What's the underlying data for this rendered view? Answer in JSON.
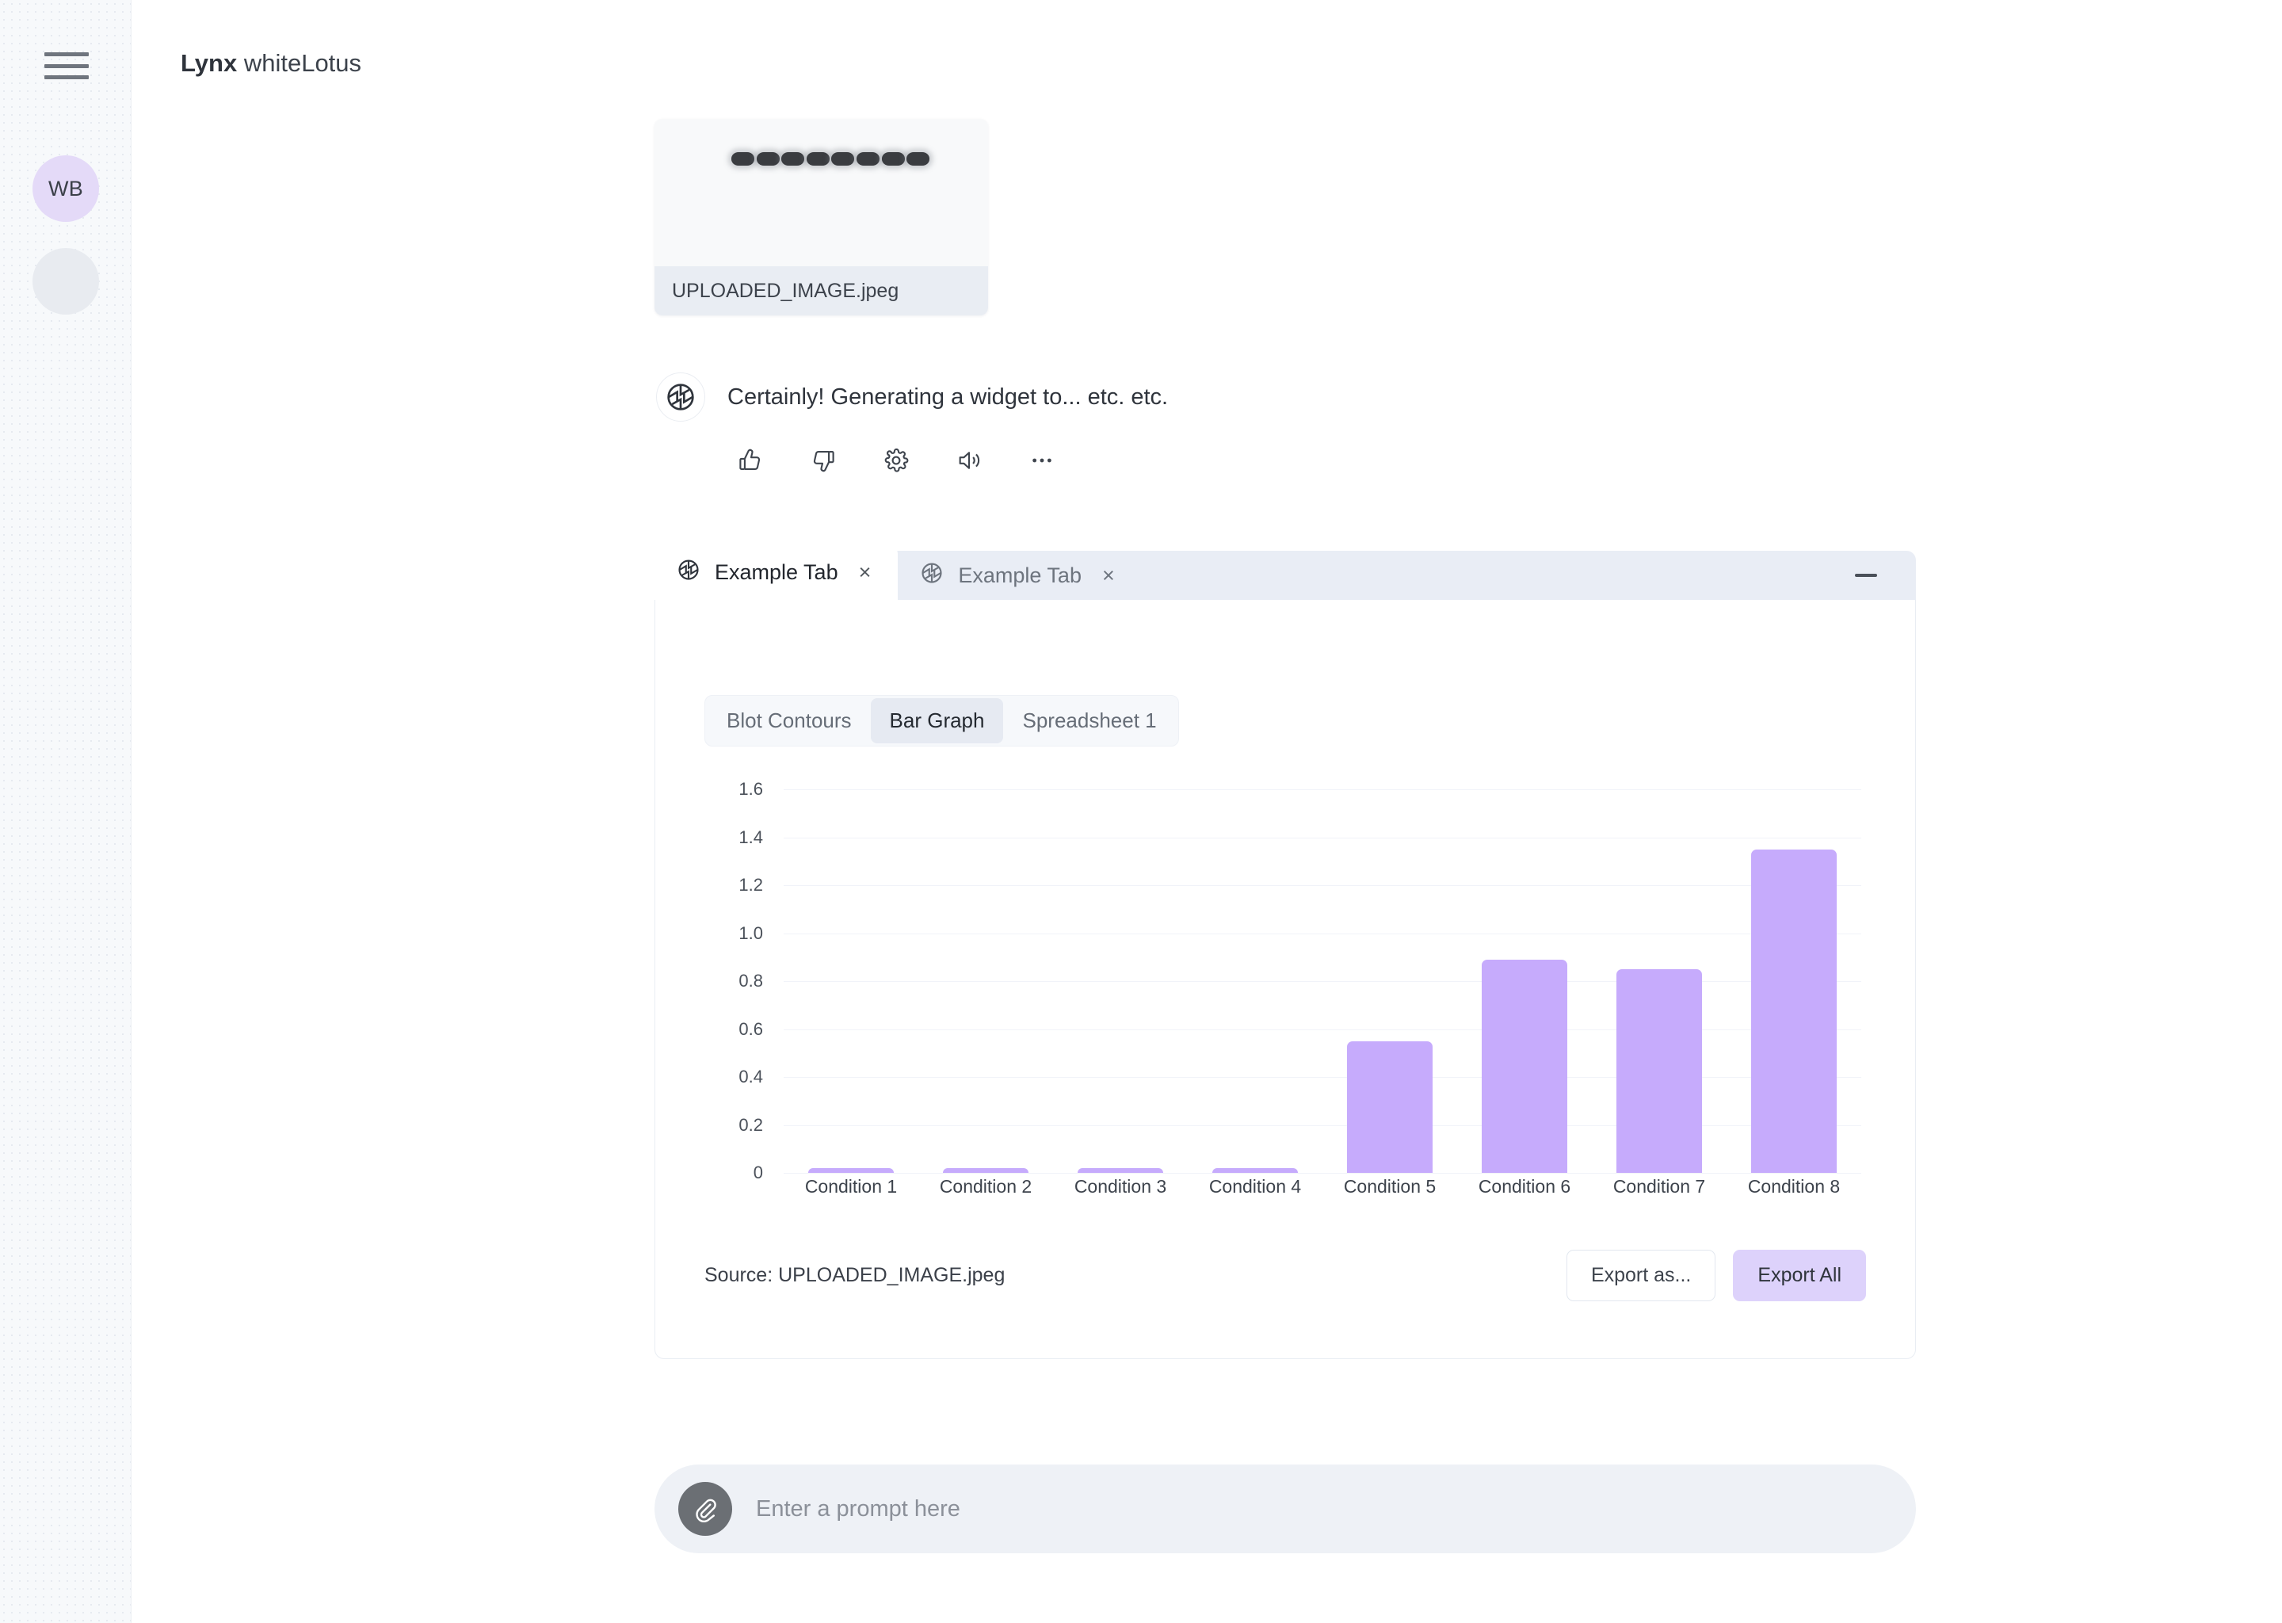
{
  "app": {
    "brand_strong": "Lynx",
    "brand_light": "whiteLotus",
    "accent": "#c6abfc",
    "accent_soft": "#ddd2fb",
    "avatar_bg": "#e4daf8"
  },
  "sidebar": {
    "menu_icon": "hamburger-icon",
    "avatar_initials": "WB",
    "placeholder_avatar": ""
  },
  "upload": {
    "filename": "UPLOADED_IMAGE.jpeg",
    "band_count": 8,
    "alt": "western-blot-strip"
  },
  "assistant": {
    "avatar_icon": "aperture-icon",
    "message": "Certainly! Generating a widget to... etc. etc.",
    "actions": [
      {
        "name": "thumbs-up-icon",
        "label": "Like"
      },
      {
        "name": "thumbs-down-icon",
        "label": "Dislike"
      },
      {
        "name": "gear-icon",
        "label": "Settings"
      },
      {
        "name": "speaker-icon",
        "label": "Read aloud"
      },
      {
        "name": "ellipsis-icon",
        "label": "More"
      }
    ]
  },
  "widget": {
    "tabs": [
      {
        "label": "Example Tab",
        "active": true,
        "close": "×"
      },
      {
        "label": "Example Tab",
        "active": false,
        "close": "×"
      }
    ],
    "minimize_label": "—",
    "segmented": [
      {
        "label": "Blot Contours",
        "active": false
      },
      {
        "label": "Bar Graph",
        "active": true
      },
      {
        "label": "Spreadsheet 1",
        "active": false
      }
    ],
    "footer": {
      "source_label": "Source:",
      "source_name": "UPLOADED_IMAGE.jpeg",
      "export_as_label": "Export as...",
      "export_all_label": "Export All"
    }
  },
  "prompt": {
    "attach_icon": "paperclip-icon",
    "placeholder": "Enter a prompt here",
    "value": ""
  },
  "chart_data": {
    "type": "bar",
    "title": "",
    "xlabel": "",
    "ylabel": "",
    "categories": [
      "Condition 1",
      "Condition 2",
      "Condition 3",
      "Condition 4",
      "Condition 5",
      "Condition 6",
      "Condition 7",
      "Condition 8"
    ],
    "values": [
      0.01,
      0.01,
      0.01,
      0.01,
      0.55,
      0.89,
      0.85,
      1.35
    ],
    "ytick_labels": [
      "1.6",
      "1.4",
      "1.2",
      "1.0",
      "0.8",
      "0.6",
      "0.4",
      "0.2",
      "0"
    ],
    "ytick_values": [
      1.6,
      1.4,
      1.2,
      1.0,
      0.8,
      0.6,
      0.4,
      0.2,
      0
    ],
    "ylim": [
      0,
      1.68
    ],
    "grid": true,
    "legend": false,
    "bar_color": "#c6abfc"
  }
}
